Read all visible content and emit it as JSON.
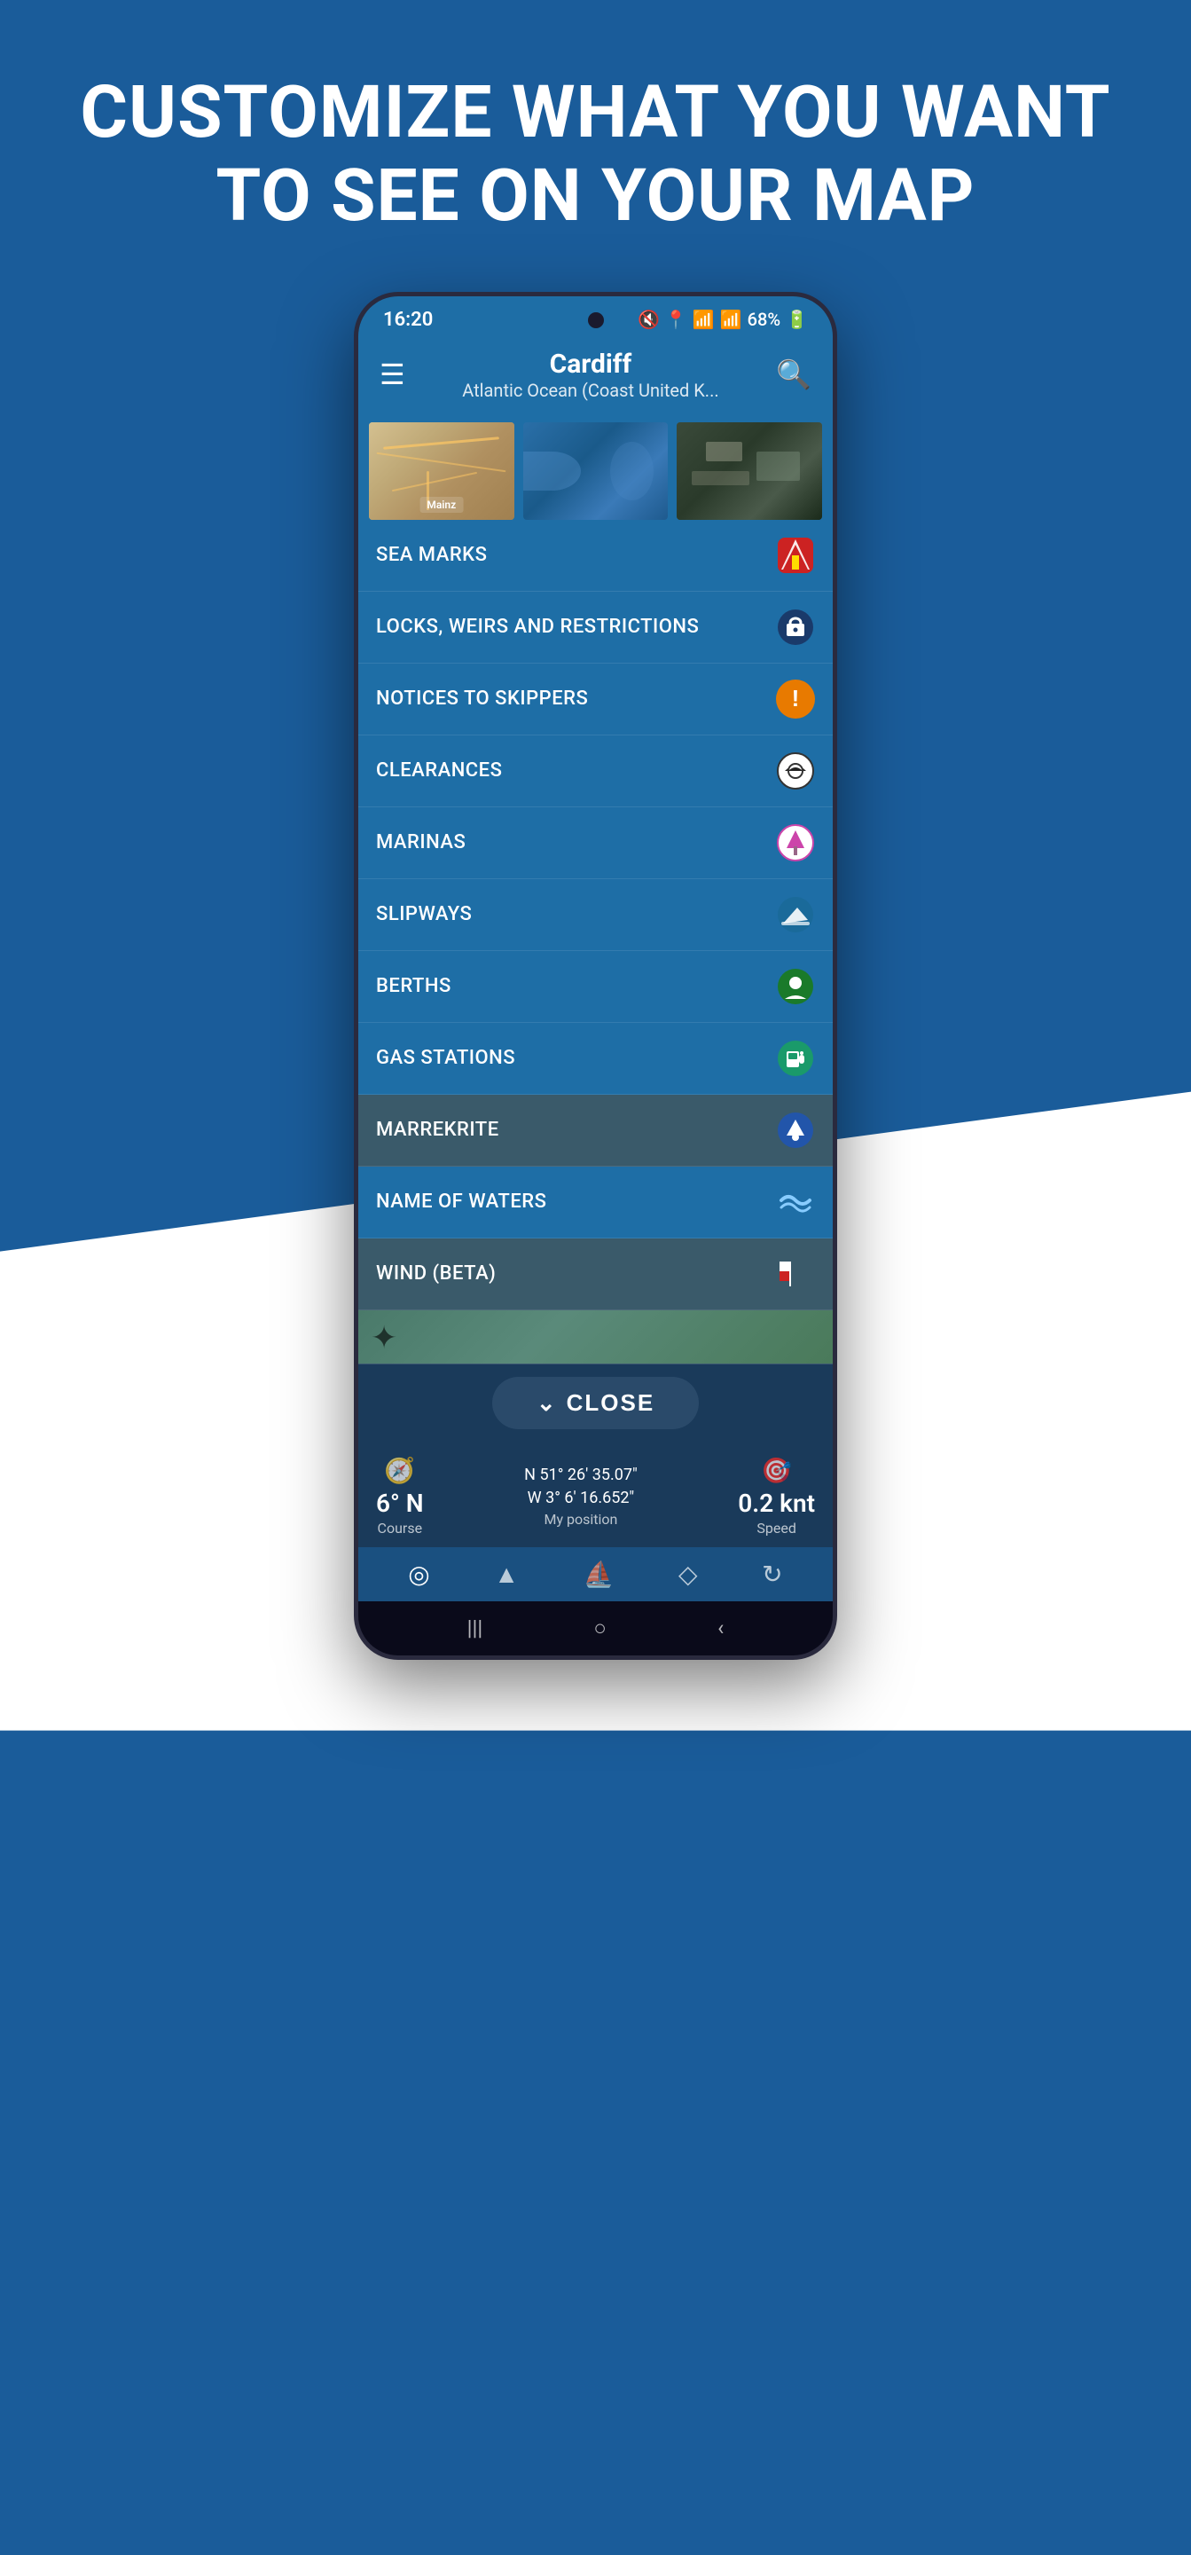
{
  "promo": {
    "title": "CUSTOMIZE WHAT YOU WANT TO SEE ON YOUR MAP"
  },
  "status_bar": {
    "time": "16:20",
    "battery": "68%",
    "icons": "🔇 📍 📶 📶 68%"
  },
  "nav": {
    "city": "Cardiff",
    "subtitle": "Atlantic Ocean (Coast United K...",
    "menu_icon": "☰",
    "search_icon": "🔍"
  },
  "map_thumbnails": [
    {
      "label": "Mainz",
      "type": "road"
    },
    {
      "label": "",
      "type": "water"
    },
    {
      "label": "",
      "type": "satellite"
    }
  ],
  "menu_items": [
    {
      "label": "SEA MARKS",
      "icon": "⛵",
      "icon_type": "sea-marks",
      "bg": "blue-bg"
    },
    {
      "label": "LOCKS, WEIRS AND RESTRICTIONS",
      "icon": "🔒",
      "icon_type": "locks",
      "bg": "blue-bg"
    },
    {
      "label": "NOTICES TO SKIPPERS",
      "icon": "!",
      "icon_type": "notices",
      "bg": "blue-bg"
    },
    {
      "label": "CLEARANCES",
      "icon": "⬛",
      "icon_type": "clearances",
      "bg": "blue-bg"
    },
    {
      "label": "MARINAS",
      "icon": "⛵",
      "icon_type": "marinas",
      "bg": "blue-bg"
    },
    {
      "label": "SLIPWAYS",
      "icon": "🚤",
      "icon_type": "slipways",
      "bg": "blue-bg"
    },
    {
      "label": "BERTHS",
      "icon": "🅿",
      "icon_type": "berths",
      "bg": "blue-bg"
    },
    {
      "label": "GAS STATIONS",
      "icon": "⛽",
      "icon_type": "gas",
      "bg": "blue-bg"
    },
    {
      "label": "MARREKRITE",
      "icon": "⛵",
      "icon_type": "marrekrite",
      "bg": "darker-bg"
    },
    {
      "label": "NAME OF WATERS",
      "icon": "〰",
      "icon_type": "waters",
      "bg": "blue-bg"
    },
    {
      "label": "WIND (BETA)",
      "icon": "🚩",
      "icon_type": "wind",
      "bg": "darker-bg"
    }
  ],
  "status_bottom": {
    "course": {
      "value": "6° N",
      "label": "Course"
    },
    "position": {
      "lat": "N 51° 26' 35.07\"",
      "lon": "W 3° 6' 16.652\"",
      "label": "My position"
    },
    "speed": {
      "value": "0.2 knt",
      "label": "Speed"
    }
  },
  "close_button": {
    "label": "CLOSE",
    "chevron": "⌄"
  },
  "bottom_nav": {
    "items": [
      {
        "icon": "◎",
        "name": "location",
        "active": false
      },
      {
        "icon": "▲",
        "name": "navigate",
        "active": false
      },
      {
        "icon": "⛵",
        "name": "boat",
        "active": false
      },
      {
        "icon": "◇",
        "name": "diamond",
        "active": false
      },
      {
        "icon": "↻",
        "name": "refresh",
        "active": false
      }
    ]
  },
  "android_nav": {
    "items": [
      "|||",
      "○",
      "‹"
    ]
  }
}
